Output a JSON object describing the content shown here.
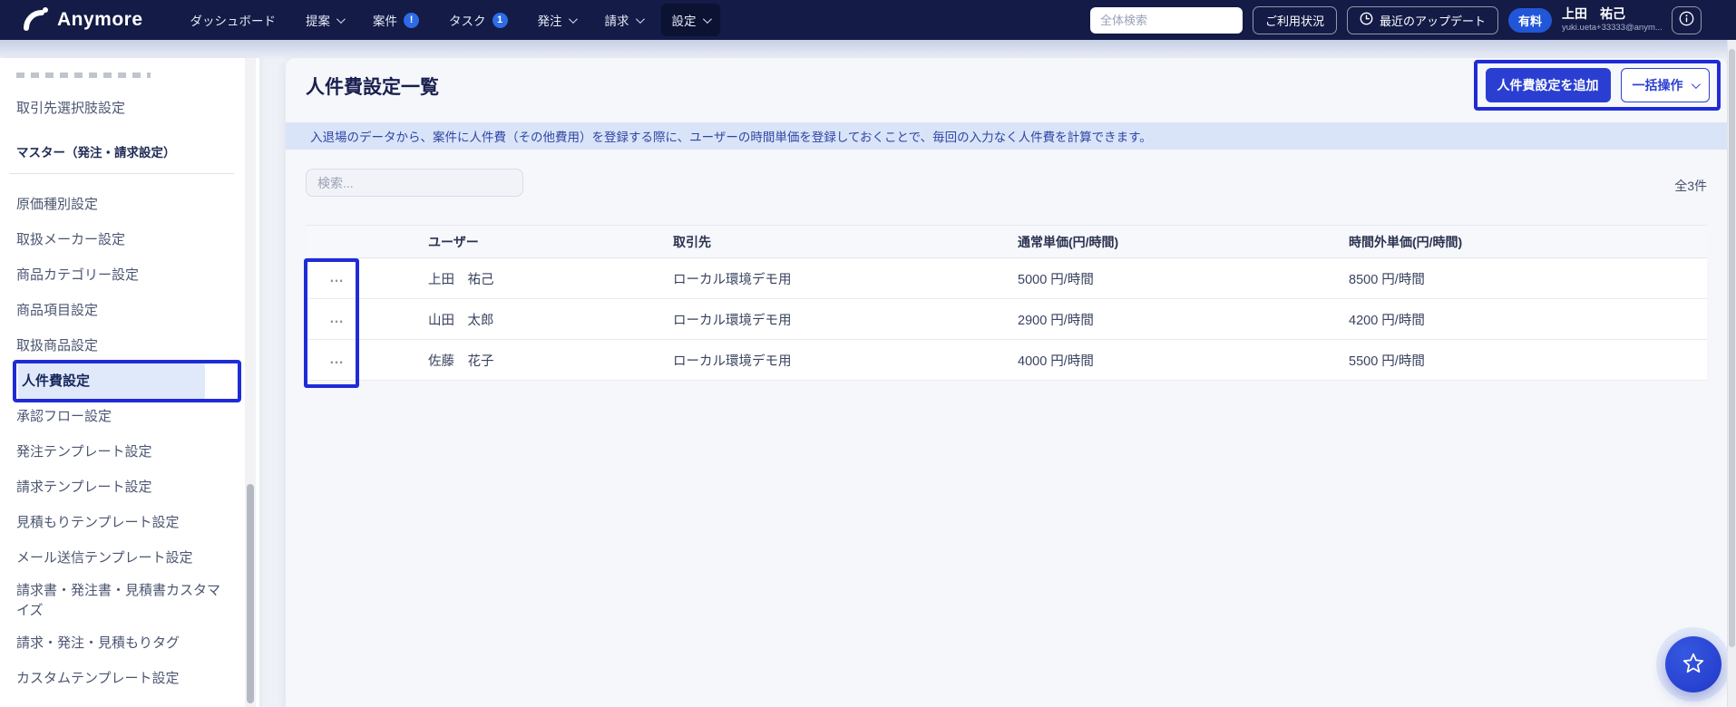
{
  "colors": {
    "annotation": "#1f2cd6",
    "primary_button": "#2a3fd2",
    "nav_bg": "#131b46",
    "badge_blue": "#2e6be6",
    "notice_bg": "#d9e4f8",
    "active_item_bg": "#dfe9f9"
  },
  "nav": {
    "logo_text": "Anymore",
    "items": [
      {
        "id": "dashboard",
        "label": "ダッシュボード"
      },
      {
        "id": "proposal",
        "label": "提案",
        "chevron": true
      },
      {
        "id": "case",
        "label": "案件",
        "badge": "!"
      },
      {
        "id": "task",
        "label": "タスク",
        "badge": "1"
      },
      {
        "id": "order",
        "label": "発注",
        "chevron": true
      },
      {
        "id": "invoice",
        "label": "請求",
        "chevron": true
      },
      {
        "id": "settings",
        "label": "設定",
        "chevron": true,
        "active": true
      }
    ],
    "search": {
      "placeholder": "全体検索"
    },
    "usage_button": "ご利用状況",
    "updates_button": "最近のアップデート",
    "plan_badge": "有料",
    "user": {
      "name": "上田　祐己",
      "email": "yuki.ueta+33333@anym..."
    }
  },
  "sidebar": {
    "items": [
      {
        "type": "clipped",
        "id": "clipped-top"
      },
      {
        "type": "item",
        "id": "client-select-options",
        "label": "取引先選択肢設定"
      },
      {
        "type": "section",
        "id": "master-section",
        "label": "マスター（発注・請求設定）"
      },
      {
        "type": "item",
        "id": "cost-type",
        "label": "原価種別設定"
      },
      {
        "type": "item",
        "id": "maker",
        "label": "取扱メーカー設定"
      },
      {
        "type": "item",
        "id": "product-category",
        "label": "商品カテゴリー設定"
      },
      {
        "type": "item",
        "id": "product-item",
        "label": "商品項目設定"
      },
      {
        "type": "item",
        "id": "products",
        "label": "取扱商品設定"
      },
      {
        "type": "item",
        "id": "labor-cost",
        "label": "人件費設定",
        "active": true
      },
      {
        "type": "item",
        "id": "approval-flow",
        "label": "承認フロー設定"
      },
      {
        "type": "item",
        "id": "order-template",
        "label": "発注テンプレート設定"
      },
      {
        "type": "item",
        "id": "invoice-template",
        "label": "請求テンプレート設定"
      },
      {
        "type": "item",
        "id": "quote-template",
        "label": "見積もりテンプレート設定"
      },
      {
        "type": "item",
        "id": "mail-template",
        "label": "メール送信テンプレート設定"
      },
      {
        "type": "item",
        "id": "doc-customize",
        "label": "請求書・発注書・見積書カスタマイズ"
      },
      {
        "type": "item",
        "id": "doc-tags",
        "label": "請求・発注・見積もりタグ"
      },
      {
        "type": "item",
        "id": "custom-template",
        "label": "カスタムテンプレート設定"
      },
      {
        "type": "clipped",
        "id": "clipped-bottom"
      }
    ]
  },
  "main": {
    "title": "人件費設定一覧",
    "add_button": "人件費設定を追加",
    "bulk_button": "一括操作",
    "notice": "入退場のデータから、案件に人件費（その他費用）を登録する際に、ユーザーの時間単価を登録しておくことで、毎回の入力なく人件費を計算できます。",
    "search_placeholder": "検索...",
    "total_count": "全3件",
    "table": {
      "columns": [
        "",
        "ユーザー",
        "取引先",
        "通常単価(円/時間)",
        "時間外単価(円/時間)"
      ],
      "row_menu_icon": "…",
      "rows": [
        {
          "user": "上田　祐己",
          "client": "ローカル環境デモ用",
          "rate": "5000 円/時間",
          "overtime": "8500 円/時間"
        },
        {
          "user": "山田　太郎",
          "client": "ローカル環境デモ用",
          "rate": "2900 円/時間",
          "overtime": "4200 円/時間"
        },
        {
          "user": "佐藤　花子",
          "client": "ローカル環境デモ用",
          "rate": "4000 円/時間",
          "overtime": "5500 円/時間"
        }
      ]
    }
  }
}
